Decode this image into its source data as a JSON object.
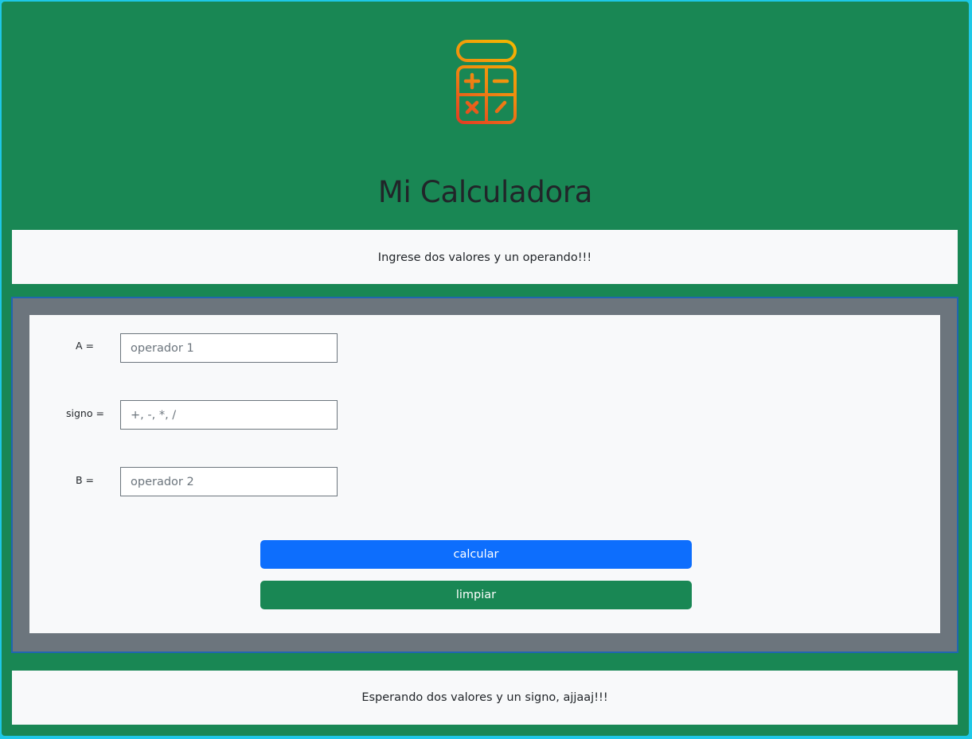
{
  "header": {
    "title": "Mi Calculadora",
    "logo_icon": "calculator-icon",
    "logo_gradient": [
      "#f5b800",
      "#e8501f"
    ]
  },
  "info_top": {
    "text": "Ingrese dos valores y un operando!!!"
  },
  "form": {
    "a_label": "A =",
    "a_placeholder": "operador 1",
    "sign_label": "signo =",
    "sign_placeholder": "+, -, *, /",
    "b_label": "B =",
    "b_placeholder": "operador 2",
    "calc_button": "calcular",
    "clear_button": "limpiar"
  },
  "result": {
    "text": "Esperando dos valores y un signo, ajjaaj!!!"
  },
  "colors": {
    "page_bg": "#198754",
    "panel_bg": "#6c757d",
    "card_bg": "#f8f9fa",
    "primary": "#0d6efd",
    "success": "#198754"
  }
}
